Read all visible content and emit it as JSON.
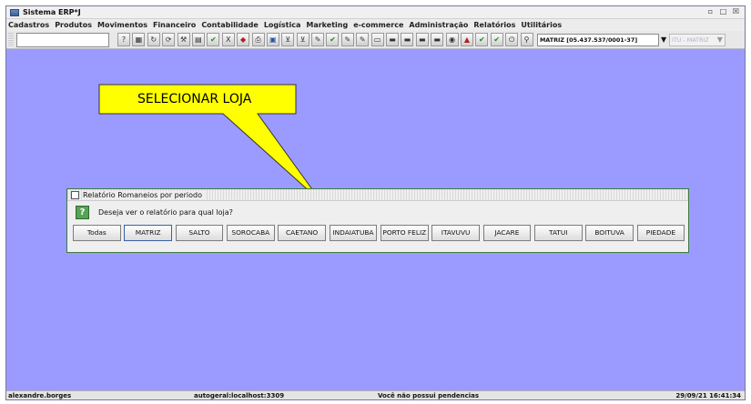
{
  "window": {
    "title": "Sistema ERP*J",
    "controls": [
      "restore-icon",
      "maximize-icon",
      "close-icon"
    ]
  },
  "menubar": {
    "items": [
      {
        "label": "Cadastros"
      },
      {
        "label": "Produtos"
      },
      {
        "label": "Movimentos"
      },
      {
        "label": "Financeiro"
      },
      {
        "label": "Contabilidade"
      },
      {
        "label": "Logística"
      },
      {
        "label": "Marketing"
      },
      {
        "label": "e-commerce"
      },
      {
        "label": "Administração"
      },
      {
        "label": "Relatórios"
      },
      {
        "label": "Utilitários"
      }
    ]
  },
  "toolbar": {
    "search_value": "",
    "icons": [
      {
        "name": "help-icon",
        "glyph": "?"
      },
      {
        "name": "calculator-icon",
        "glyph": "▦"
      },
      {
        "name": "refresh-icon",
        "glyph": "↻"
      },
      {
        "name": "refresh-all-icon",
        "glyph": "⟳"
      },
      {
        "name": "tools-icon",
        "glyph": "⚒"
      },
      {
        "name": "grid-icon",
        "glyph": "▤"
      },
      {
        "name": "confirm-icon",
        "glyph": "✔",
        "tone": "green"
      },
      {
        "name": "cancel-icon",
        "glyph": "X"
      },
      {
        "name": "gem-icon",
        "glyph": "◆",
        "tone": "red"
      },
      {
        "name": "print-icon",
        "glyph": "⎙"
      },
      {
        "name": "image-icon",
        "glyph": "▣",
        "tone": "blue"
      },
      {
        "name": "cart-icon",
        "glyph": "⊻"
      },
      {
        "name": "cart-add-icon",
        "glyph": "⊻"
      },
      {
        "name": "edit-icon",
        "glyph": "✎"
      },
      {
        "name": "approve-icon",
        "glyph": "✔",
        "tone": "green"
      },
      {
        "name": "edit-doc-icon",
        "glyph": "✎"
      },
      {
        "name": "edit-doc-alt-icon",
        "glyph": "✎"
      },
      {
        "name": "card-icon",
        "glyph": "▭"
      },
      {
        "name": "register-icon",
        "glyph": "▬"
      },
      {
        "name": "register-alt-icon",
        "glyph": "▬"
      },
      {
        "name": "register-out-icon",
        "glyph": "▬"
      },
      {
        "name": "register-in-icon",
        "glyph": "▬"
      },
      {
        "name": "coins-icon",
        "glyph": "◉"
      },
      {
        "name": "alert-icon",
        "glyph": "▲",
        "tone": "red"
      },
      {
        "name": "check-icon",
        "glyph": "✔",
        "tone": "green"
      },
      {
        "name": "check-alt-icon",
        "glyph": "✔",
        "tone": "green"
      },
      {
        "name": "power-icon",
        "glyph": "⏻"
      },
      {
        "name": "search-icon",
        "glyph": "⚲"
      }
    ],
    "company_value": "MATRIZ [05.437.537/0001-37]",
    "store_value": "ITU - MATRIZ"
  },
  "callout": {
    "text": "SELECIONAR LOJA",
    "color": "#ffff00"
  },
  "dialog": {
    "title": "Relatório Romaneios por periodo",
    "question": "Deseja ver o relatório para qual loja?",
    "buttons": [
      {
        "label": "Todas"
      },
      {
        "label": "MATRIZ"
      },
      {
        "label": "SALTO"
      },
      {
        "label": "SOROCABA"
      },
      {
        "label": "CAETANO"
      },
      {
        "label": "INDAIATUBA"
      },
      {
        "label": "PORTO FELIZ"
      },
      {
        "label": "ITAVUVU"
      },
      {
        "label": "JACARE"
      },
      {
        "label": "TATUI"
      },
      {
        "label": "BOITUVA"
      },
      {
        "label": "PIEDADE"
      }
    ]
  },
  "statusbar": {
    "user": "alexandre.borges",
    "connection": "autogeral:localhost:3309",
    "pending": "Você não possui pendencias",
    "datetime": "29/09/21 16:41:34"
  },
  "colors": {
    "desktop": "#9b9bff",
    "dialog_border": "#3d7a3d",
    "callout": "#ffff00"
  }
}
